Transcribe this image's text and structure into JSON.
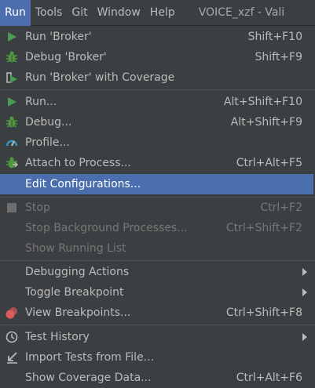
{
  "menubar": {
    "items": [
      {
        "label": "Run"
      },
      {
        "label": "Tools"
      },
      {
        "label": "Git"
      },
      {
        "label": "Window"
      },
      {
        "label": "Help"
      }
    ],
    "title": "VOICE_xzf - Vali"
  },
  "menu": {
    "items": [
      {
        "label": "Run 'Broker'",
        "shortcut": "Shift+F10",
        "icon": "run-icon"
      },
      {
        "label": "Debug 'Broker'",
        "shortcut": "Shift+F9",
        "icon": "debug-icon"
      },
      {
        "label": "Run 'Broker' with Coverage",
        "shortcut": "",
        "icon": "coverage-icon"
      },
      {
        "label": "Run...",
        "shortcut": "Alt+Shift+F10",
        "icon": "run-icon"
      },
      {
        "label": "Debug...",
        "shortcut": "Alt+Shift+F9",
        "icon": "debug-icon"
      },
      {
        "label": "Profile...",
        "shortcut": "",
        "icon": "profile-icon"
      },
      {
        "label": "Attach to Process...",
        "shortcut": "Ctrl+Alt+F5",
        "icon": "attach-debugger-icon"
      },
      {
        "label": "Edit Configurations...",
        "shortcut": "",
        "icon": ""
      },
      {
        "label": "Stop",
        "shortcut": "Ctrl+F2",
        "icon": "stop-icon"
      },
      {
        "label": "Stop Background Processes...",
        "shortcut": "Ctrl+Shift+F2",
        "icon": ""
      },
      {
        "label": "Show Running List",
        "shortcut": "",
        "icon": ""
      },
      {
        "label": "Debugging Actions",
        "shortcut": "",
        "icon": ""
      },
      {
        "label": "Toggle Breakpoint",
        "shortcut": "",
        "icon": ""
      },
      {
        "label": "View Breakpoints...",
        "shortcut": "Ctrl+Shift+F8",
        "icon": "breakpoints-icon"
      },
      {
        "label": "Test History",
        "shortcut": "",
        "icon": "history-icon"
      },
      {
        "label": "Import Tests from File...",
        "shortcut": "",
        "icon": "import-icon"
      },
      {
        "label": "Show Coverage Data...",
        "shortcut": "Ctrl+Alt+F6",
        "icon": ""
      }
    ]
  },
  "colors": {
    "background": "#3c3f41",
    "selection": "#4b6eaf",
    "run_green": "#499c54",
    "debug_green": "#4e9a3f",
    "breakpoint_red": "#db5c5c",
    "profile_blue": "#3592c4",
    "text": "#bbbbbb",
    "disabled_text": "#777777"
  }
}
